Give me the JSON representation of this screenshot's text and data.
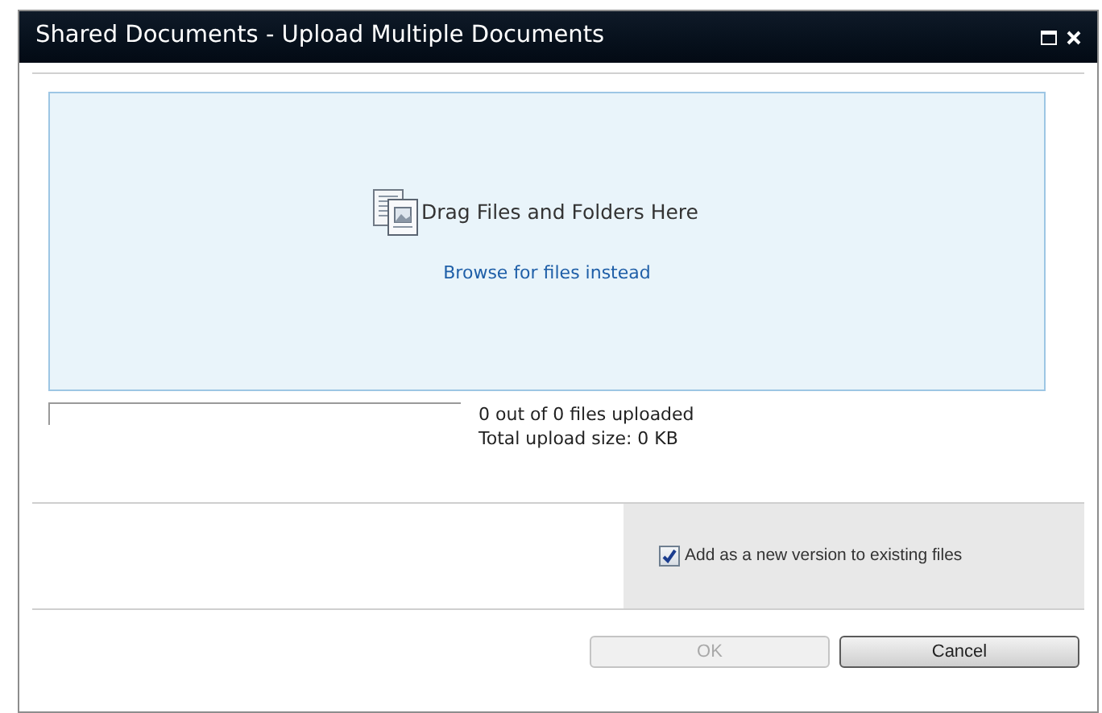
{
  "window": {
    "title": "Shared Documents - Upload Multiple Documents"
  },
  "drop_zone": {
    "label": "Drag Files and Folders Here",
    "link": "Browse for files instead"
  },
  "progress": {
    "level": 0,
    "status": "0 out of 0 files uploaded",
    "size": "Total upload size: 0 KB"
  },
  "options": [
    {
      "label": "Add as a new version to existing files",
      "checked": true
    }
  ],
  "buttons": [
    {
      "label": "OK",
      "disabled": true
    },
    {
      "label": "Cancel",
      "disabled": false
    }
  ]
}
